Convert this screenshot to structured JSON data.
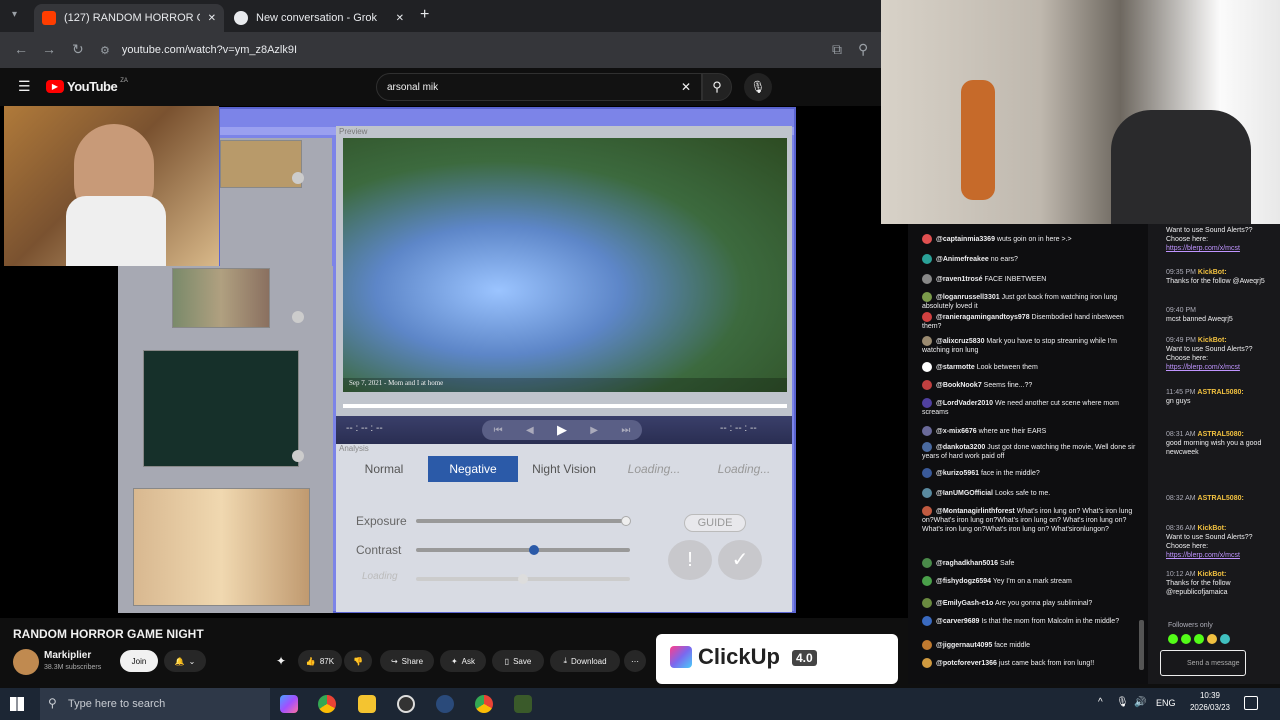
{
  "browser": {
    "tabs": [
      {
        "label": "(127) RANDOM HORROR G",
        "active": true
      },
      {
        "label": "New conversation - Grok",
        "active": false
      }
    ],
    "new_tab_icon": "plus-icon",
    "url": "youtube.com/watch?v=ym_z8Azlk9I"
  },
  "youtube": {
    "logo_text": "YouTube",
    "logo_region": "ZA",
    "search_value": "arsonal mik",
    "video_title": "RANDOM HORROR GAME NIGHT",
    "channel_name": "Markiplier",
    "subscribers": "38.3M subscribers",
    "join_label": "Join",
    "likes": "87K",
    "share_label": "Share",
    "ask_label": "Ask",
    "save_label": "Save",
    "download_label": "Download",
    "ad_brand": "ClickUp",
    "ad_version": "4.0"
  },
  "game": {
    "preview_label": "Preview",
    "caption": "Sep 7, 2021 - Mom and I at home",
    "time_left": "-- : -- : --",
    "time_right": "-- : -- : --",
    "analysis_label": "Analysis",
    "modes": [
      "Normal",
      "Negative",
      "Night Vision",
      "Loading...",
      "Loading..."
    ],
    "selected_mode": "Negative",
    "sliders": [
      {
        "label": "Exposure",
        "value": 1.0
      },
      {
        "label": "Contrast",
        "value": 0.55
      },
      {
        "label": "Loading",
        "value": 0.5
      }
    ],
    "guide_label": "GUIDE"
  },
  "chat": {
    "messages": [
      {
        "user": "@captainmia3369",
        "text": "wuts goin on in here >.>",
        "color": "#e05050"
      },
      {
        "user": "@Animefreakee",
        "text": "no ears?",
        "color": "#2aa198"
      },
      {
        "user": "@raven1trosé",
        "text": "FACE INBETWEEN",
        "color": "#888888"
      },
      {
        "user": "@loganrussell3301",
        "text": "Just got back from watching iron lung absolutely loved it",
        "color": "#7a9a4a"
      },
      {
        "user": "@ranieragamingandtoys978",
        "text": "Disembodied hand inbetween them?",
        "color": "#d04040"
      },
      {
        "user": "@alixcruz5830",
        "text": "Mark you have to stop streaming while I'm watching iron lung",
        "color": "#9a8a70"
      },
      {
        "user": "@starmotte",
        "text": "Look between them",
        "color": "#ffffff"
      },
      {
        "user": "@BookNook7",
        "text": "Seems fine...??",
        "color": "#c04040"
      },
      {
        "user": "@LordVader2010",
        "text": "We need another cut scene where mom screams",
        "color": "#5040a0"
      },
      {
        "user": "@x-mix6676",
        "text": "where are their EARS",
        "color": "#6a6a9a"
      },
      {
        "user": "@dankota3200",
        "text": "Just got done watching the movie, Well done sir years of hard work paid off",
        "color": "#4a6aa0"
      },
      {
        "user": "@kurizo5961",
        "text": "face in the middle?",
        "color": "#3a5a9a"
      },
      {
        "user": "@IanUMGOfficial",
        "text": "Looks safe to me.",
        "color": "#5a8aa0"
      },
      {
        "user": "@Montanagirlinthforest",
        "text": "What's iron lung on? What's iron lung on?What's iron lung on?What's iron lung on? What's iron lung on?What's iron lung on?What's iron lung on? What'sironlungon?",
        "color": "#c05a40"
      },
      {
        "user": "@raghadkhan5016",
        "text": "Safe",
        "color": "#4a8a4a"
      },
      {
        "user": "@fishydogz6594",
        "text": "Yey I'm on a mark stream",
        "color": "#4aa04a"
      },
      {
        "user": "@EmilyGash-e1o",
        "text": "Are you gonna play subliminal?",
        "color": "#6a8a40"
      },
      {
        "user": "@carver9689",
        "text": "Is that the mom from Malcolm in the middle?",
        "color": "#3a6ac0"
      },
      {
        "user": "@jiggernaut4095",
        "text": "face middle",
        "color": "#c07a30"
      },
      {
        "user": "@potcforever1366",
        "text": "just came back from iron lung!!",
        "color": "#d09a40"
      }
    ]
  },
  "sidechat": {
    "items": [
      {
        "time": "",
        "user": "",
        "text": "Want to use Sound Alerts?? Choose here:",
        "link": "https://blerp.com/x/mcst"
      },
      {
        "time": "09:35 PM",
        "user": "KickBot:",
        "text": "Thanks for the follow @Aweqrj5",
        "link": ""
      },
      {
        "time": "09:40 PM",
        "user": "",
        "text": "mcst banned Aweqrj5",
        "link": ""
      },
      {
        "time": "09:49 PM",
        "user": "KickBot:",
        "text": "Want to use Sound Alerts?? Choose here:",
        "link": "https://blerp.com/x/mcst"
      },
      {
        "time": "11:45 PM",
        "user": "ASTRAL5080:",
        "text": "gn guys",
        "link": ""
      },
      {
        "time": "08:31 AM",
        "user": "ASTRAL5080:",
        "text": "good morning wish you a good newcweek",
        "link": ""
      },
      {
        "time": "08:32 AM",
        "user": "ASTRAL5080:",
        "text": "",
        "link": ""
      },
      {
        "time": "08:36 AM",
        "user": "KickBot:",
        "text": "Want to use Sound Alerts?? Choose here:",
        "link": "https://blerp.com/x/mcst"
      },
      {
        "time": "10:12 AM",
        "user": "KickBot:",
        "text": "Thanks for the follow @republicofjamaica",
        "link": ""
      }
    ],
    "followers_only": "Followers only",
    "send_placeholder": "Send a message"
  },
  "taskbar": {
    "search_placeholder": "Type here to search",
    "language": "ENG",
    "time": "10:39",
    "date": "2026/03/23"
  }
}
